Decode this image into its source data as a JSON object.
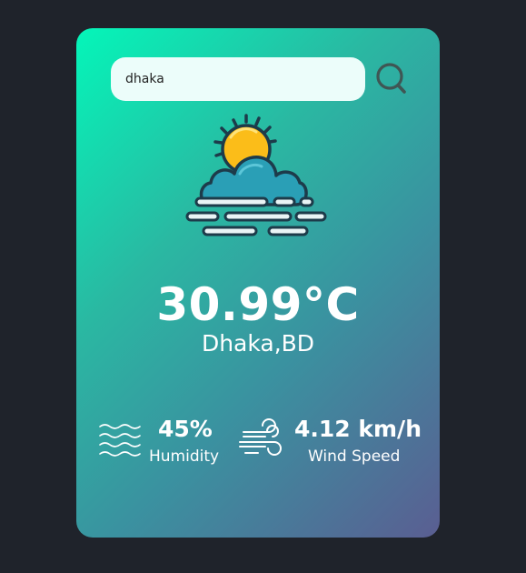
{
  "search": {
    "value": "dhaka",
    "icon": "search-icon"
  },
  "weather": {
    "icon": "sun-behind-cloud-mist-icon",
    "temperature": "30.99°C",
    "location": "Dhaka,BD"
  },
  "stats": {
    "humidity": {
      "icon": "humidity-waves-icon",
      "value": "45%",
      "label": "Humidity"
    },
    "wind": {
      "icon": "wind-icon",
      "value": "4.12 km/h",
      "label": "Wind Speed"
    }
  },
  "colors": {
    "page_background": "#1f232b",
    "card_gradient_start": "#04f6b9",
    "card_gradient_end": "#5a5e92",
    "sun": "#fbbd19",
    "cloud": "#2a9fb6",
    "outline": "#1d3b4a"
  }
}
